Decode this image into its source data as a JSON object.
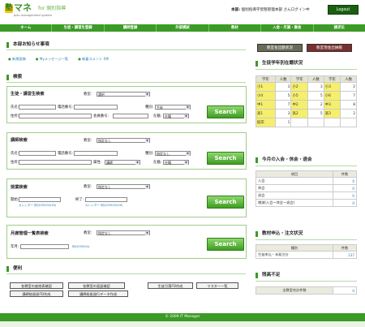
{
  "header": {
    "logo_mark": "塾",
    "logo_text": "マネ",
    "logo_suffix": "for 個別指導",
    "logo_tagline": "Juku management system",
    "user_prefix": "本部:",
    "user_text": "個別指導学習塾管理本部 さんログイン中",
    "logout_label": "Logout"
  },
  "nav": [
    "ホーム",
    "生徒・講習生登録",
    "講師登録",
    "外部模試",
    "教材",
    "入金・月謝・集金",
    "請求伝"
  ],
  "news": {
    "title": "本部お知らせ事項",
    "items": [
      {
        "label": "新規投稿"
      },
      {
        "label": "Myメッセージ一覧"
      },
      {
        "label": "新着コメント",
        "count": "0件"
      }
    ]
  },
  "search": {
    "title": "検索",
    "student": {
      "title": "生徒・講習生検索",
      "classroom_label": "教室:",
      "classroom_value": "選択",
      "name_label": "氏名:",
      "phone_label": "電話番号:",
      "kind_label": "種別:",
      "kind_value": "生徒",
      "address_label": "住所:",
      "member_label": "会員番号:",
      "status_label": "在籍:",
      "status_value": "在籍",
      "button": "Search"
    },
    "teacher": {
      "title": "講師検索",
      "classroom_label": "教室:",
      "classroom_value": "指定なし",
      "name_label": "氏名:",
      "phone_label": "電話番号:",
      "kind_label": "種別:",
      "kind_value": "指定なし",
      "address_label": "住所:",
      "role_label": "属性:",
      "role_value": "講師",
      "status_label": "在籍:",
      "status_value": "在籍",
      "button": "Search"
    },
    "lesson": {
      "title": "授業検索",
      "classroom_label": "教室:",
      "classroom_value": "指定なし",
      "start_label": "開始:",
      "end_label": "終了:",
      "start_hint": "カレンダー 例(2009/04/16)",
      "end_hint": "カレンダー 例(2009/04/16)",
      "button": "Search"
    },
    "monthly": {
      "title": "月謝管理一覧表検索",
      "classroom_label": "教室:",
      "classroom_value": "指定なし",
      "month_label": "年月:",
      "month_hint": "例(2009/04)",
      "button": "Search"
    }
  },
  "convenience": {
    "title": "便利",
    "row1": [
      "各教室の座席表確認",
      "各教室の面談確認",
      "生徒引落FD作成",
      "マスター一覧"
    ],
    "row2": [
      "講師給振発FD作成",
      "講師給振発行データ作成"
    ]
  },
  "right": {
    "btn_classroom": "教室長出勤状況",
    "btn_cash": "教室現金出納帳",
    "grade_title": "生徒学年別在籍状況",
    "grade_headers": [
      "学年",
      "人数",
      "学年",
      "人数",
      "学年",
      "人数"
    ],
    "grade_rows": [
      [
        "小1",
        "3",
        "小2",
        "3",
        "小3",
        "2"
      ],
      [
        "小4",
        "5",
        "小5",
        "5",
        "小6",
        "7"
      ],
      [
        "中1",
        "7",
        "中2",
        "2",
        "中3",
        "8"
      ],
      [
        "高1",
        "3",
        "高2",
        "5",
        "高3",
        "2"
      ],
      [
        "既卒",
        "1",
        "",
        "",
        "",
        ""
      ]
    ],
    "month_title": "今月の入会・休会・退会",
    "month_headers": [
      "項目",
      "件数"
    ],
    "month_rows": [
      [
        "入会",
        "0"
      ],
      [
        "休会",
        "0"
      ],
      [
        "退会",
        "0"
      ],
      [
        "増減(入会ー休会ー退会)",
        "0"
      ]
    ],
    "material_title": "教材申込・注文状況",
    "material_headers": [
      "種別",
      "件数"
    ],
    "material_rows": [
      [
        "生徒申込・未発注分",
        "137"
      ]
    ],
    "shortage_title": "残高不足",
    "shortage_rows": [
      [
        "全教室合計件数",
        "0"
      ]
    ]
  },
  "footer": "© 2009 IT Manager"
}
